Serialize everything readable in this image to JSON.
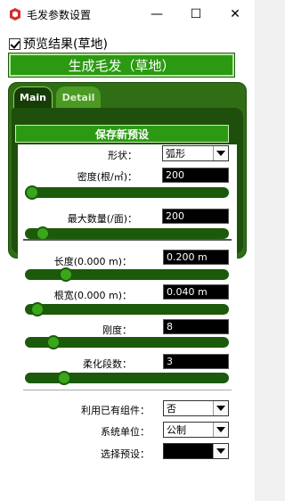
{
  "window": {
    "title": "毛发参数设置",
    "min_glyph": "—",
    "max_glyph": "☐",
    "close_glyph": "✕"
  },
  "preview": {
    "label": "预览结果(草地)",
    "checked": true
  },
  "generate_button": "生成毛发（草地）",
  "tabs": [
    {
      "label": "Main",
      "active": true
    },
    {
      "label": "Detail",
      "active": false
    }
  ],
  "preset_header": "保存新预设",
  "main": {
    "shape": {
      "label": "形状：",
      "value": "弧形"
    },
    "density": {
      "label": "密度(根/㎡)：",
      "value": "200",
      "slider_fraction": 0.02
    },
    "max_count": {
      "label": "最大数量(/面)：",
      "value": "200",
      "slider_fraction": 0.06
    }
  },
  "detail": {
    "length": {
      "label": "长度(0.000 m)：",
      "value": "0.200 m",
      "slider_fraction": 0.19
    },
    "root_width": {
      "label": "根宽(0.000 m)：",
      "value": "0.040 m",
      "slider_fraction": 0.03
    },
    "stiffness": {
      "label": "刚度：",
      "value": "8",
      "slider_fraction": 0.11
    },
    "soft_segments": {
      "label": "柔化段数：",
      "value": "3",
      "slider_fraction": 0.17
    }
  },
  "footer": {
    "use_component": {
      "label": "利用已有组件：",
      "value": "否"
    },
    "units": {
      "label": "系统单位：",
      "value": "公制"
    },
    "select_preset": {
      "label": "选择预设：",
      "value": ""
    }
  },
  "colors": {
    "accent_green": "#2b9a12",
    "panel_green": "#2f6e14",
    "dark_green": "#1f4f0c",
    "slider_track": "#1b5a0a",
    "slider_thumb": "#3ba51c",
    "app_icon": "#d62b2b"
  },
  "icons": {
    "app": "sketchup-icon",
    "dropdown": "chevron-down-icon"
  }
}
